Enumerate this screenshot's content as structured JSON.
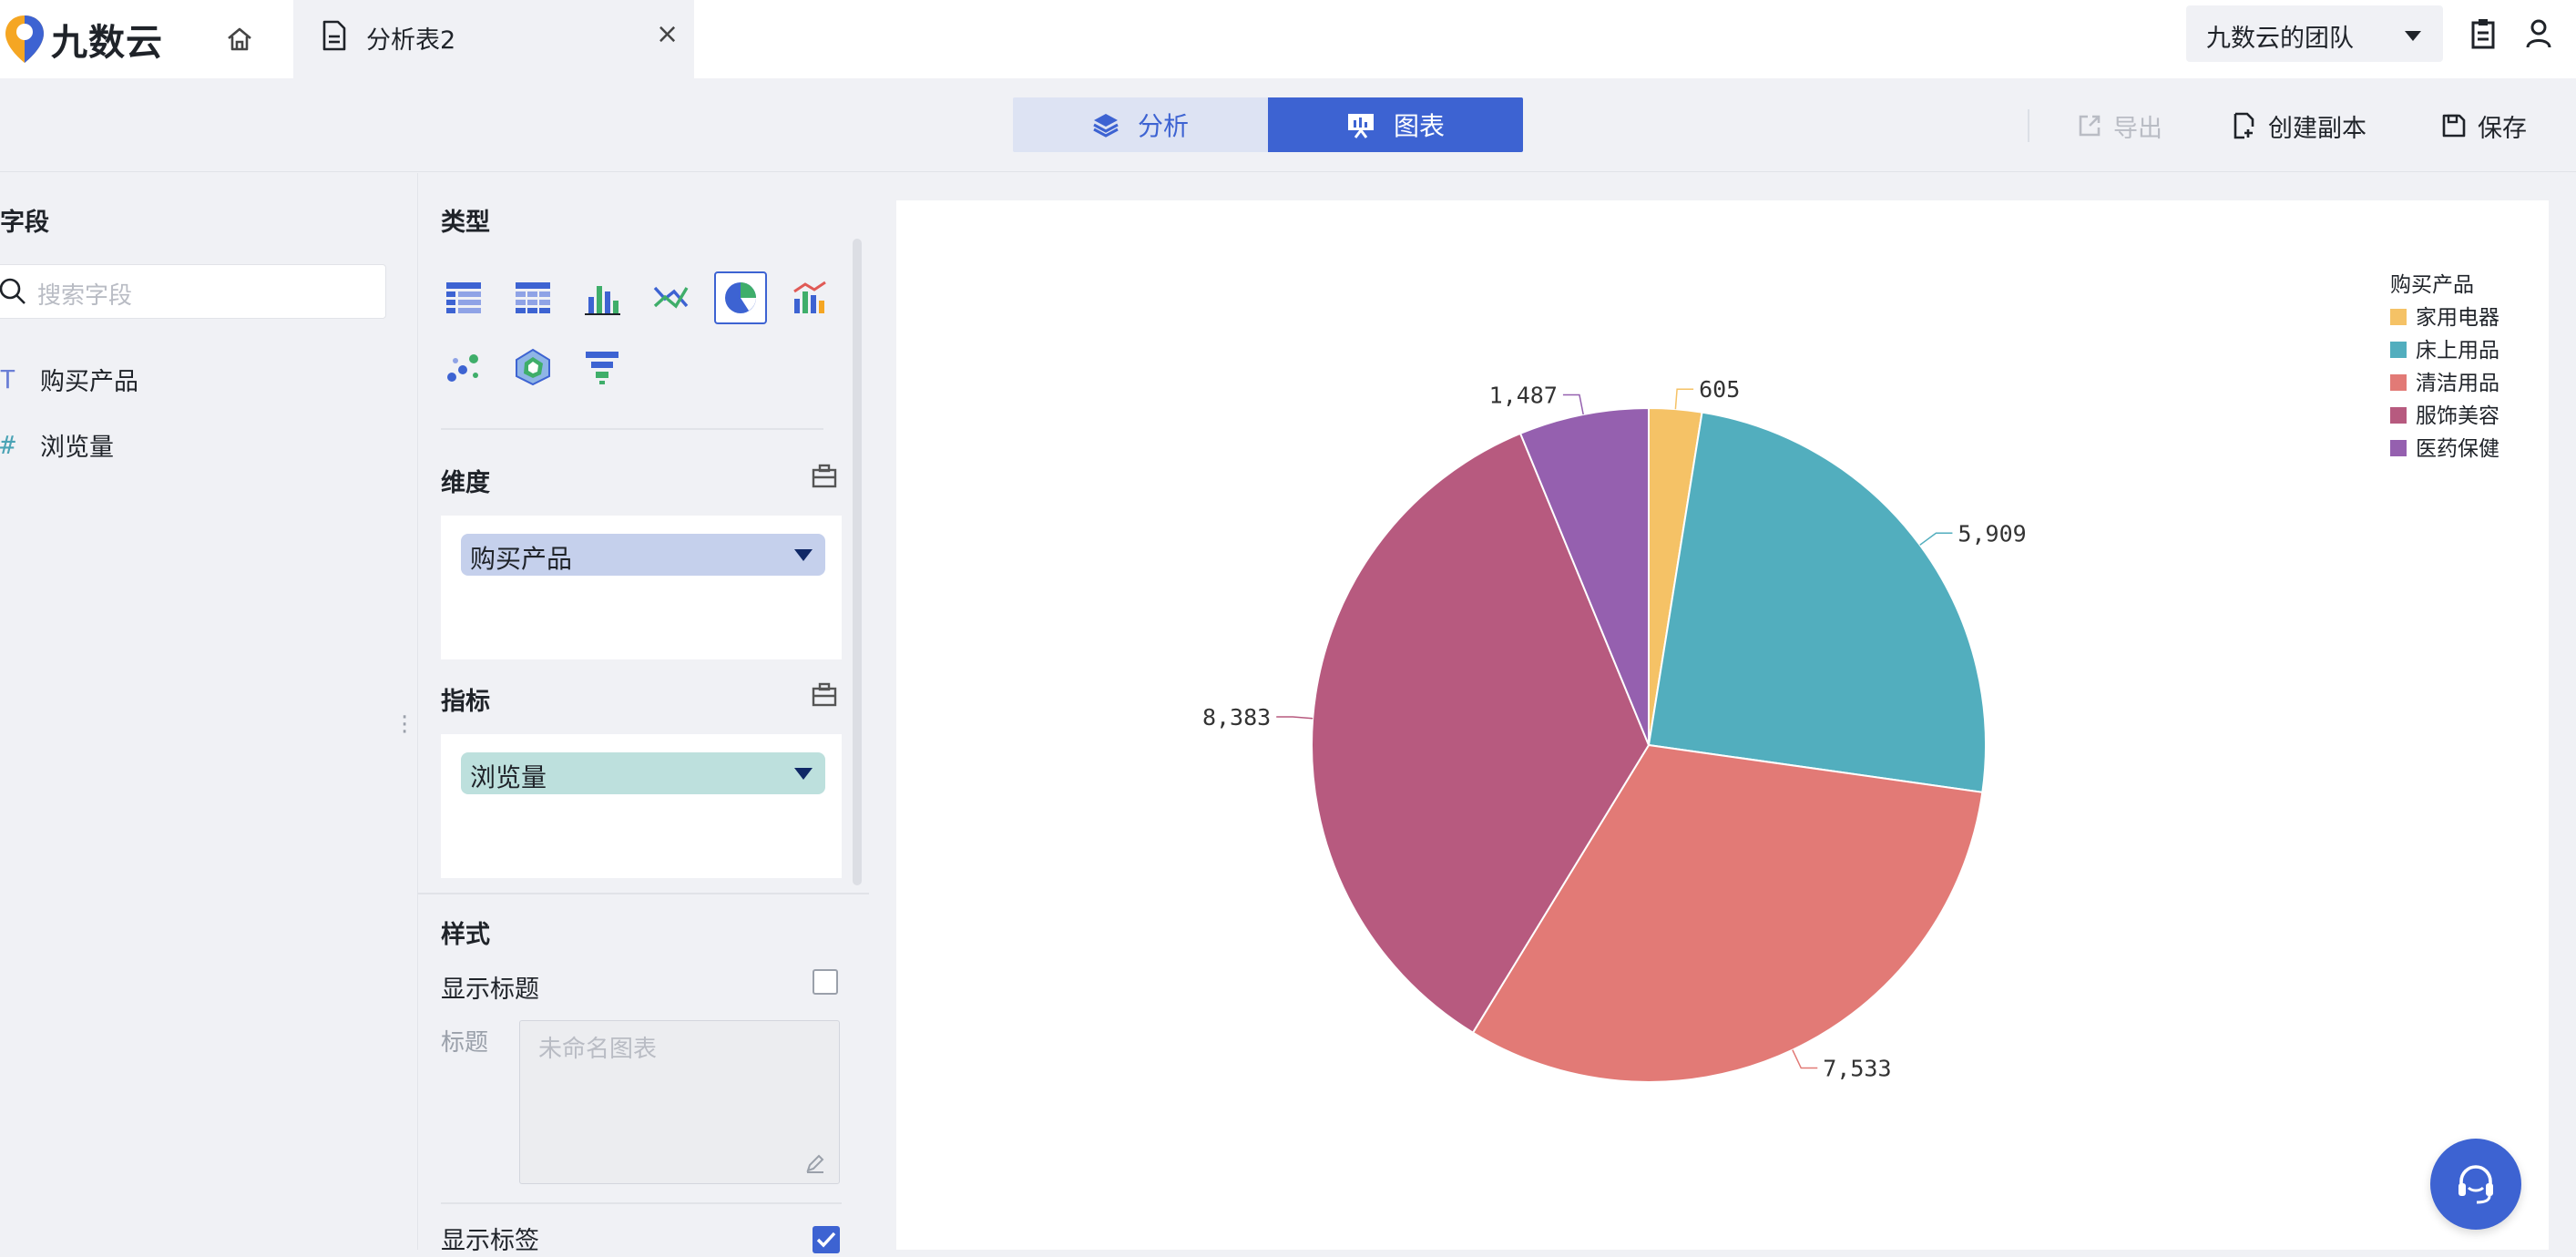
{
  "brand": {
    "name": "九数云"
  },
  "tabs": [
    {
      "label": "分析表2"
    }
  ],
  "team": {
    "label": "九数云的团队"
  },
  "view_switch": {
    "analysis": "分析",
    "chart": "图表",
    "active": "chart"
  },
  "actions": {
    "export": "导出",
    "copy": "创建副本",
    "save": "保存"
  },
  "fields": {
    "title": "字段",
    "search_placeholder": "搜索字段",
    "items": [
      {
        "label": "购买产品",
        "kind": "text",
        "icon": "T"
      },
      {
        "label": "浏览量",
        "kind": "number",
        "icon": "#"
      }
    ]
  },
  "config": {
    "type_title": "类型",
    "chart_types": [
      "table-icon",
      "cross-table-icon",
      "bar-chart-icon",
      "line-chart-icon",
      "pie-chart-icon",
      "combo-chart-icon",
      "scatter-chart-icon",
      "radar-chart-icon",
      "funnel-chart-icon"
    ],
    "selected_type": "pie-chart-icon",
    "dimension_title": "维度",
    "dimension_value": "购买产品",
    "metric_title": "指标",
    "metric_value": "浏览量",
    "style_title": "样式",
    "show_title_label": "显示标题",
    "show_title_checked": false,
    "title_label": "标题",
    "title_placeholder": "未命名图表",
    "show_label_label": "显示标签",
    "show_label_checked": true
  },
  "chart_data": {
    "type": "pie",
    "title": "",
    "legend_title": "购买产品",
    "legend_position": "top-right",
    "labels_shown": true,
    "slices": [
      {
        "name": "家用电器",
        "value": 605,
        "label": "605",
        "color": "#f5c266"
      },
      {
        "name": "床上用品",
        "value": 5909,
        "label": "5,909",
        "color": "#52aebe"
      },
      {
        "name": "清洁用品",
        "value": 7533,
        "label": "7,533",
        "color": "#e27a76"
      },
      {
        "name": "服饰美容",
        "value": 8383,
        "label": "8,383",
        "color": "#b75a7f"
      },
      {
        "name": "医药保健",
        "value": 1487,
        "label": "1,487",
        "color": "#9560af"
      }
    ]
  },
  "colors": {
    "accent": "#3d63d2",
    "page_bg": "#f0f1f5"
  }
}
